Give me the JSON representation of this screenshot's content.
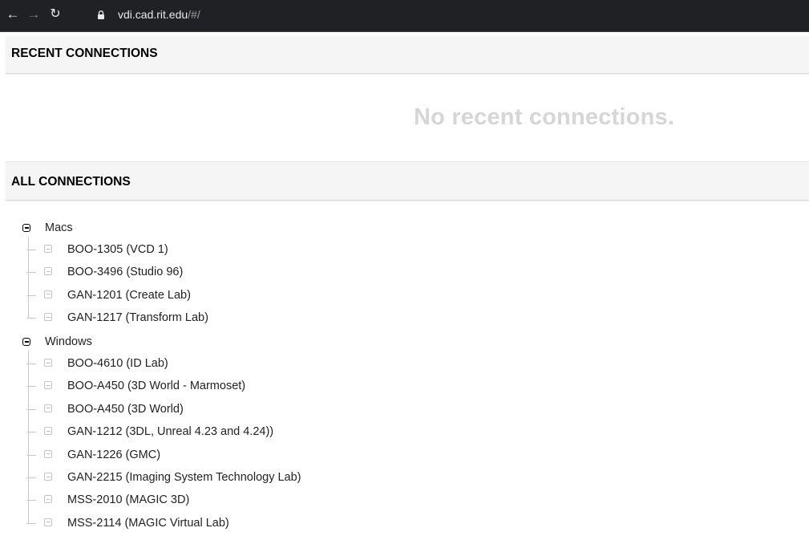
{
  "browser": {
    "url_host": "vdi.cad.rit.edu",
    "url_path": "/#/"
  },
  "recent": {
    "header": "RECENT CONNECTIONS",
    "empty_message": "No recent connections."
  },
  "all": {
    "header": "ALL CONNECTIONS",
    "groups": [
      {
        "label": "Macs",
        "items": [
          "BOO-1305 (VCD 1)",
          "BOO-3496 (Studio 96)",
          "GAN-1201 (Create Lab)",
          "GAN-1217 (Transform Lab)"
        ]
      },
      {
        "label": "Windows",
        "items": [
          "BOO-4610 (ID Lab)",
          "BOO-A450 (3D World - Marmoset)",
          "BOO-A450 (3D World)",
          "GAN-1212 (3DL, Unreal 4.23 and 4.24))",
          "GAN-1226 (GMC)",
          "GAN-2215 (Imaging System Technology Lab)",
          "MSS-2010 (MAGIC 3D)",
          "MSS-2114 (MAGIC Virtual Lab)"
        ]
      }
    ]
  }
}
